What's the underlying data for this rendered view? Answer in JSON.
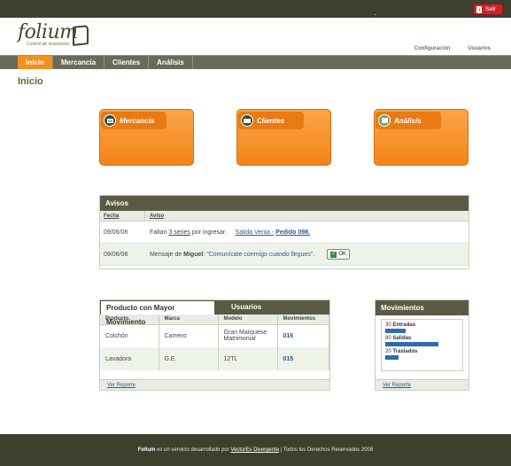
{
  "app": {
    "logo_word": "folium",
    "logo_tag": "Control de inventarios"
  },
  "topbar": {
    "logout_label": "Salir"
  },
  "header_links": [
    "Configuración",
    "Usuarios"
  ],
  "nav": {
    "tabs": [
      "Inicio",
      "Mercancía",
      "Clientes",
      "Análisis"
    ],
    "active": "Inicio"
  },
  "page_title": "Inicio",
  "modules": [
    {
      "label": "Mercancía",
      "icon": "monitor-icon"
    },
    {
      "label": "Clientes",
      "icon": "id-card-icon"
    },
    {
      "label": "Análisis",
      "icon": "bar-chart-icon"
    }
  ],
  "avisos": {
    "title": "Avisos",
    "col_fecha": "Fecha",
    "col_aviso": "Aviso",
    "rows": [
      {
        "fecha": "09/06/08",
        "pre": "Faltan ",
        "series": "3 series",
        "mid": " por ingresar.",
        "link1": "Salida Venta - ",
        "link2": "Pedido 098."
      },
      {
        "fecha": "09/06/08",
        "pre": "Mensaje de ",
        "user": "Miguel",
        "colon": ": ",
        "quote": "\"Comunícate conmigo cuando llegues\".",
        "ok": "OK"
      }
    ]
  },
  "producto": {
    "tab_active": "Producto con Mayor Movimiento",
    "tab_inactive": "Usuarios",
    "columns": [
      "Producto",
      "Marca",
      "Modelo",
      "Movimientos"
    ],
    "rows": [
      [
        "Colchón",
        "Carreiro",
        "Gran Marquese Matrimonial",
        "016"
      ],
      [
        "Lavadora",
        "G.E.",
        "12TL",
        "015"
      ]
    ],
    "footer_link": "Ver Reporte"
  },
  "movimientos": {
    "title": "Movimientos",
    "items": [
      {
        "count": "30",
        "label": "Entradas",
        "value": 30
      },
      {
        "count": "80",
        "label": "Salidas",
        "value": 80
      },
      {
        "count": "20",
        "label": "Traslados",
        "value": 20
      }
    ],
    "footer_link": "Ver Reporte",
    "bar_color": "#2e6bb0"
  },
  "footer": {
    "brand": "Folium",
    "text1": " es un servicio desarrollado por ",
    "company": "VectorEs Divergente",
    "text2": " | Todos los Derechos Reservados 2008"
  },
  "colors": {
    "accent": "#f28f1d",
    "dark": "#3f3f2f",
    "nav": "#6a6a58",
    "title": "#5a6b2a"
  }
}
